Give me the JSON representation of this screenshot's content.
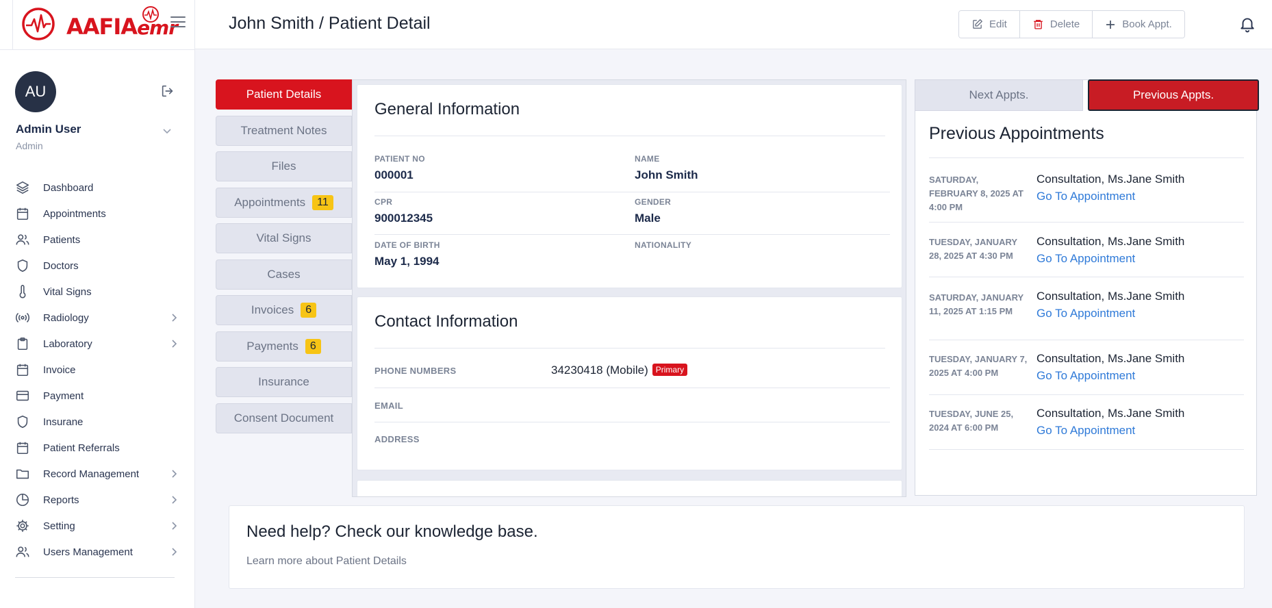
{
  "brand": {
    "name_main": "AAFIA",
    "name_suffix": "emr"
  },
  "user": {
    "initials": "AU",
    "name": "Admin User",
    "role": "Admin"
  },
  "sidebar": {
    "items": [
      {
        "label": "Dashboard",
        "icon": "layers-icon"
      },
      {
        "label": "Appointments",
        "icon": "calendar-icon"
      },
      {
        "label": "Patients",
        "icon": "users-icon"
      },
      {
        "label": "Doctors",
        "icon": "shield-icon"
      },
      {
        "label": "Vital Signs",
        "icon": "thermometer-icon"
      },
      {
        "label": "Radiology",
        "icon": "radio-icon"
      },
      {
        "label": "Laboratory",
        "icon": "clipboard-icon"
      },
      {
        "label": "Invoice",
        "icon": "calendar-icon"
      },
      {
        "label": "Payment",
        "icon": "credit-card-icon"
      },
      {
        "label": "Insurane",
        "icon": "shield-icon"
      },
      {
        "label": "Patient Referrals",
        "icon": "calendar-icon"
      },
      {
        "label": "Record Management",
        "icon": "folder-icon"
      },
      {
        "label": "Reports",
        "icon": "pie-chart-icon"
      },
      {
        "label": "Setting",
        "icon": "gear-icon"
      },
      {
        "label": "Users Management",
        "icon": "users-icon"
      }
    ]
  },
  "header": {
    "title": "John Smith / Patient Detail",
    "edit_label": "Edit",
    "delete_label": "Delete",
    "book_label": "Book Appt."
  },
  "tabs": [
    {
      "label": "Patient Details",
      "badge": ""
    },
    {
      "label": "Treatment Notes",
      "badge": ""
    },
    {
      "label": "Files",
      "badge": ""
    },
    {
      "label": "Appointments",
      "badge": "11"
    },
    {
      "label": "Vital Signs",
      "badge": ""
    },
    {
      "label": "Cases",
      "badge": ""
    },
    {
      "label": "Invoices",
      "badge": "6"
    },
    {
      "label": "Payments",
      "badge": "6"
    },
    {
      "label": "Insurance",
      "badge": ""
    },
    {
      "label": "Consent Document",
      "badge": ""
    }
  ],
  "general": {
    "title": "General Information",
    "patient_no_label": "PATIENT NO",
    "patient_no": "000001",
    "name_label": "NAME",
    "name": "John Smith",
    "cpr_label": "CPR",
    "cpr": "900012345",
    "gender_label": "GENDER",
    "gender": "Male",
    "dob_label": "DATE OF BIRTH",
    "dob": "May 1, 1994",
    "nationality_label": "NATIONALITY",
    "nationality": ""
  },
  "contact": {
    "title": "Contact Information",
    "phone_label": "PHONE NUMBERS",
    "phone": "34230418 (Mobile)",
    "phone_badge": "Primary",
    "email_label": "EMAIL",
    "address_label": "ADDRESS"
  },
  "appointments": {
    "next_tab": "Next Appts.",
    "prev_tab": "Previous Appts.",
    "title": "Previous Appointments",
    "link_label": "Go To Appointment",
    "items": [
      {
        "date": "SATURDAY, FEBRUARY 8, 2025 AT 4:00 PM",
        "title": "Consultation, Ms.Jane Smith"
      },
      {
        "date": "TUESDAY, JANUARY 28, 2025 AT 4:30 PM",
        "title": "Consultation, Ms.Jane Smith"
      },
      {
        "date": "SATURDAY, JANUARY 11, 2025 AT 1:15 PM",
        "title": "Consultation, Ms.Jane Smith"
      },
      {
        "date": "TUESDAY, JANUARY 7, 2025 AT 4:00 PM",
        "title": "Consultation, Ms.Jane Smith"
      },
      {
        "date": "TUESDAY, JUNE 25, 2024 AT 6:00 PM",
        "title": "Consultation, Ms.Jane Smith"
      }
    ]
  },
  "help": {
    "title": "Need help? Check our knowledge base.",
    "text": "Learn more about Patient Details"
  },
  "colors": {
    "brand_red": "#d8141e",
    "badge_yellow": "#f7c415",
    "link_blue": "#2f7ad8",
    "dark_navy": "#273146"
  }
}
